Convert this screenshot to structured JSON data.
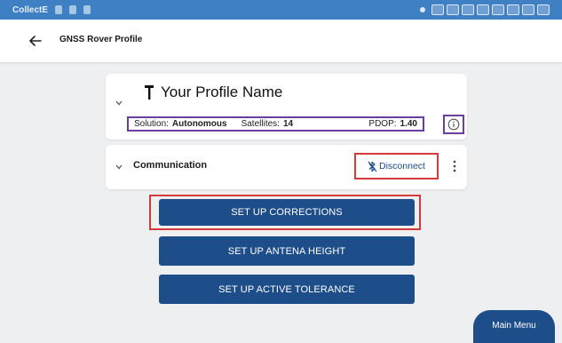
{
  "status_bar": {
    "app_label": "CollectE"
  },
  "header": {
    "title": "GNSS Rover Profile",
    "back_icon": "arrow-left-icon"
  },
  "profile": {
    "name": "Your Profile Name",
    "solution_label": "Solution:",
    "solution_value": "Autonomous",
    "satellites_label": "Satellites:",
    "satellites_value": "14",
    "pdop_label": "PDOP:",
    "pdop_value": "1.40"
  },
  "communication": {
    "label": "Communication",
    "disconnect_label": "Disconnect"
  },
  "actions": {
    "corrections": "SET UP CORRECTIONS",
    "antena_height": "SET UP ANTENA HEIGHT",
    "active_tolerance": "SET UP ACTIVE TOLERANCE"
  },
  "main_menu": {
    "label": "Main Menu"
  },
  "colors": {
    "status_bar": "#3f7fc4",
    "primary_button": "#1e4e8a",
    "highlight_purple": "#6a3fa1",
    "highlight_red": "#d33b3b"
  }
}
